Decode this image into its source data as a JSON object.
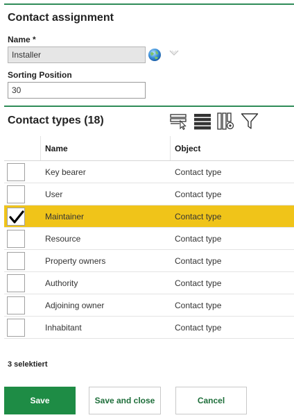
{
  "form": {
    "title": "Contact assignment",
    "name_label": "Name *",
    "name_value": "Installer",
    "sorting_label": "Sorting Position",
    "sorting_value": "30"
  },
  "contact_types": {
    "title": "Contact types (18)",
    "toolbar_icons": [
      "row-select-icon",
      "list-view-icon",
      "column-settings-icon",
      "filter-icon"
    ],
    "columns": {
      "name": "Name",
      "object": "Object"
    },
    "rows": [
      {
        "name": "Key bearer",
        "object": "Contact type",
        "checked": false,
        "highlighted": false
      },
      {
        "name": "User",
        "object": "Contact type",
        "checked": false,
        "highlighted": false
      },
      {
        "name": "Maintainer",
        "object": "Contact type",
        "checked": true,
        "highlighted": true
      },
      {
        "name": "Resource",
        "object": "Contact type",
        "checked": false,
        "highlighted": false
      },
      {
        "name": "Property owners",
        "object": "Contact type",
        "checked": false,
        "highlighted": false
      },
      {
        "name": "Authority",
        "object": "Contact type",
        "checked": false,
        "highlighted": false
      },
      {
        "name": "Adjoining owner",
        "object": "Contact type",
        "checked": false,
        "highlighted": false
      },
      {
        "name": "Inhabitant",
        "object": "Contact type",
        "checked": false,
        "highlighted": false
      }
    ],
    "selected_text": "3 selektiert"
  },
  "buttons": {
    "save": "Save",
    "save_close": "Save and close",
    "cancel": "Cancel"
  },
  "colors": {
    "accent_green": "#1e8c45",
    "rule_green": "#2e8b57",
    "highlight_yellow": "#f0c419"
  }
}
